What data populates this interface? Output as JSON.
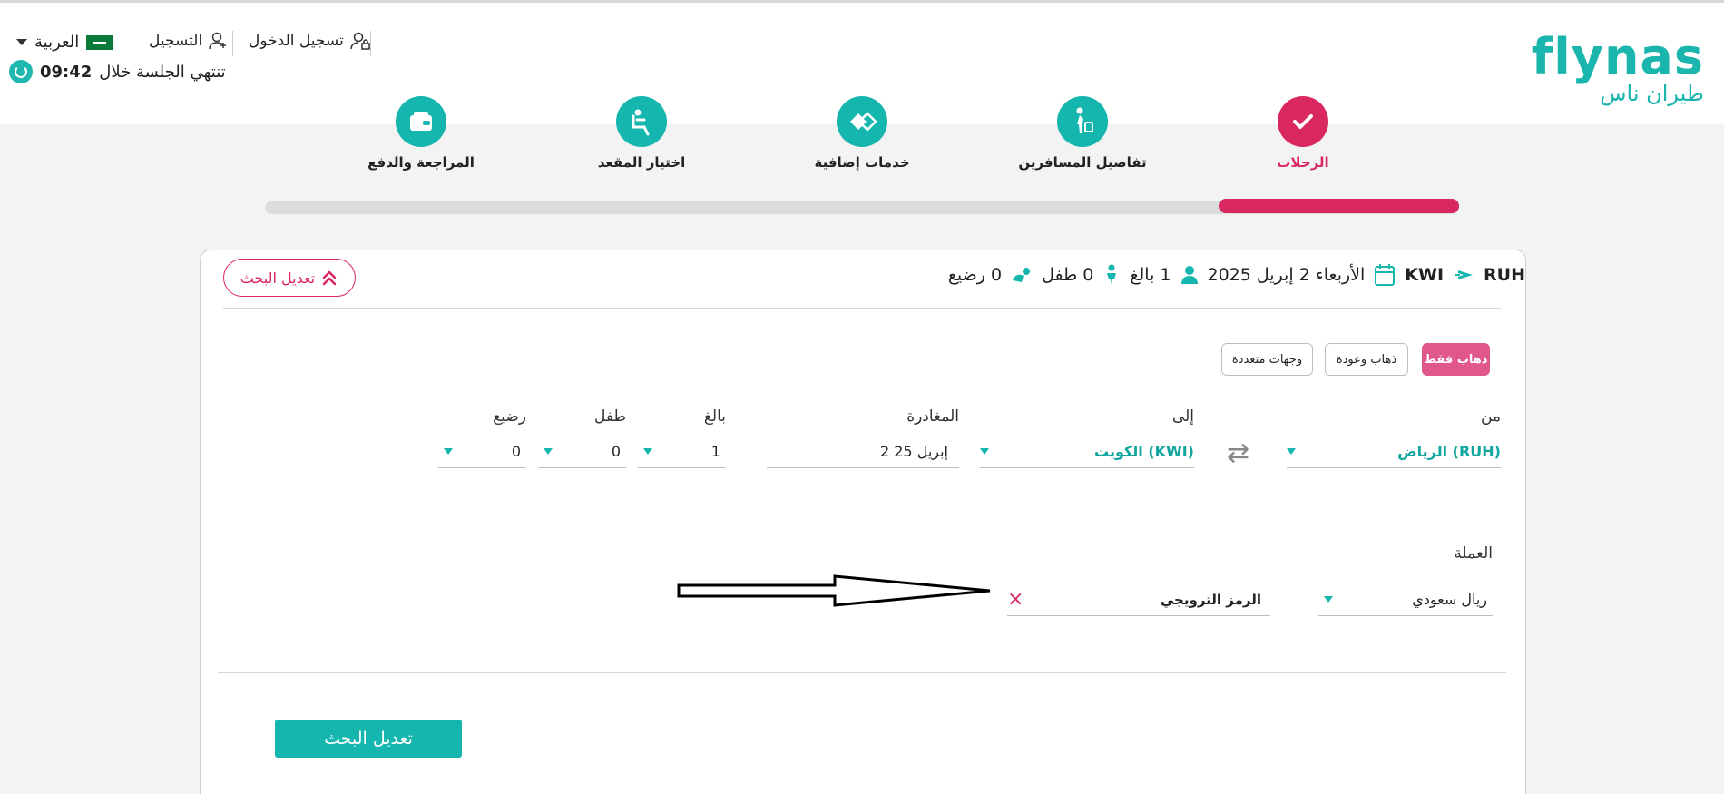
{
  "header": {
    "language": "العربية",
    "register_label": "التسجيل",
    "login_label": "تسجيل الدخول",
    "session_text": "تنتهي الجلسة خلال",
    "session_time": "09:42",
    "logo_latin": "flynas",
    "logo_arabic": "طيران ناس"
  },
  "steps": [
    {
      "label": "الرحلات",
      "icon": "check-icon",
      "active": true
    },
    {
      "label": "تفاصيل المسافرين",
      "icon": "traveler-icon",
      "active": false
    },
    {
      "label": "خدمات إضافية",
      "icon": "tickets-icon",
      "active": false
    },
    {
      "label": "اختيار المقعد",
      "icon": "seat-icon",
      "active": false
    },
    {
      "label": "المراجعة والدفع",
      "icon": "wallet-icon",
      "active": false
    }
  ],
  "progress": {
    "fraction": 0.2
  },
  "summary": {
    "origin": "RUH",
    "destination": "KWI",
    "date": "الأربعاء 2 إبريل 2025",
    "adults": "1 بالغ",
    "children": "0 طفل",
    "infants": "0 رضيع",
    "modify_label": "تعديل البحث"
  },
  "trip_types": {
    "one_way": "ذهاب فقط",
    "round_trip": "ذهاب وعودة",
    "multi_city": "وجهات متعددة",
    "selected": "ذهاب فقط"
  },
  "form": {
    "from_label": "من",
    "from_value": "الرياض (RUH)",
    "to_label": "إلى",
    "to_value": "الكويت (KWI)",
    "departure_label": "المغادرة",
    "departure_value": "2 إبريل 25",
    "adult_label": "بالغ",
    "adult_value": "1",
    "child_label": "طفل",
    "child_value": "0",
    "infant_label": "رضيع",
    "infant_value": "0",
    "currency_label": "العملة",
    "currency_value": "ريال سعودي",
    "promo_placeholder": "الرمز الترويجي",
    "submit_label": "تعديل البحث"
  },
  "colors": {
    "brand_teal": "#14b6ae",
    "brand_pink": "#d9285f"
  }
}
